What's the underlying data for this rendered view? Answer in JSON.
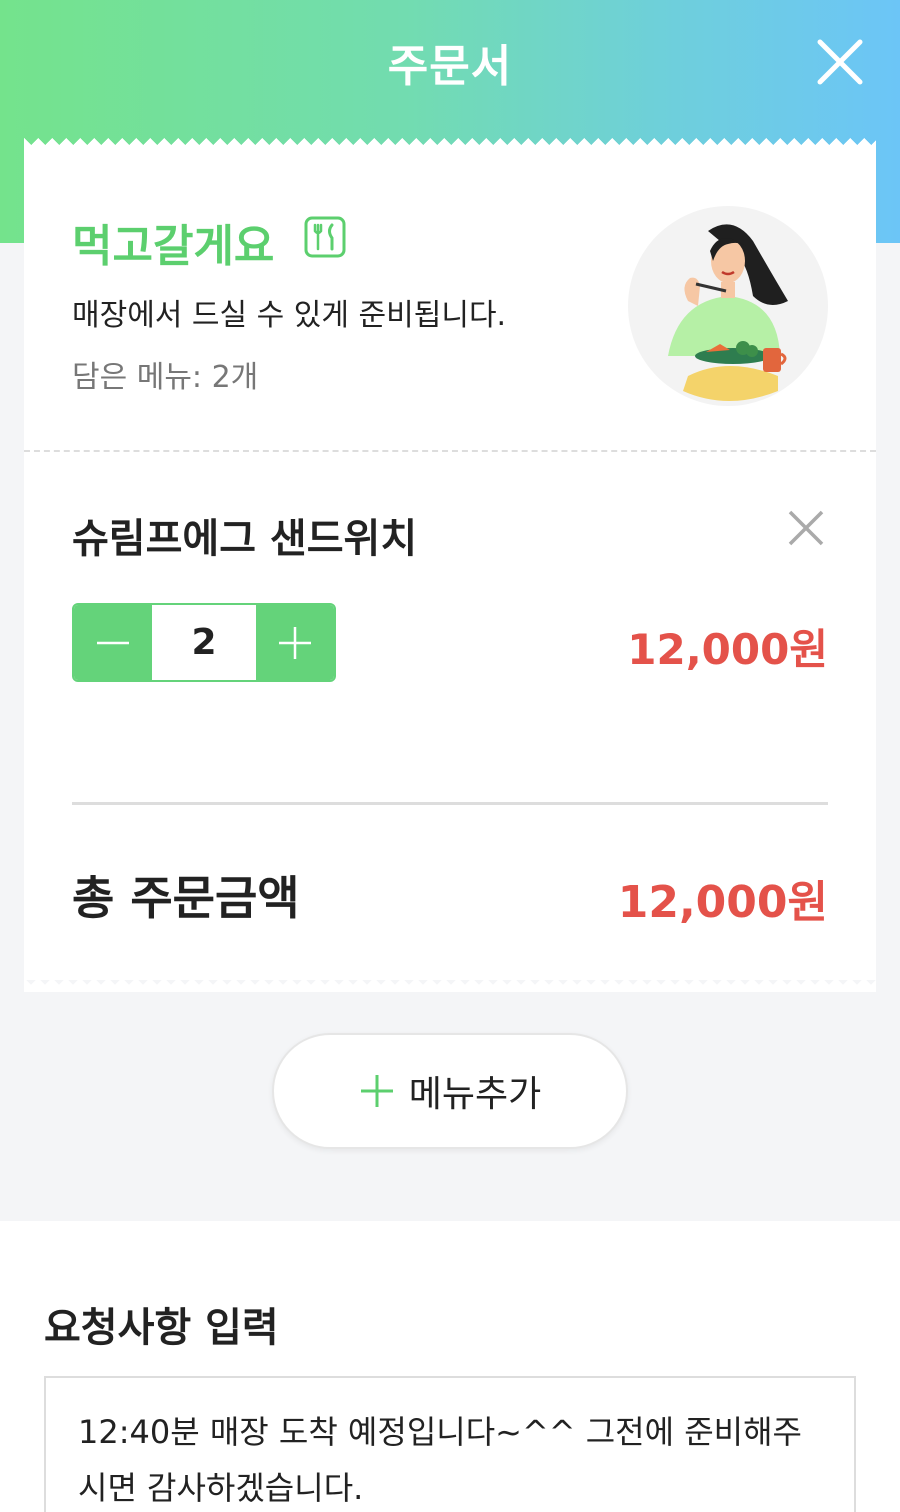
{
  "header": {
    "title": "주문서"
  },
  "dine_option": {
    "title": "먹고갈게요",
    "description": "매장에서 드실 수 있게 준비됩니다.",
    "menu_count": "담은 메뉴: 2개"
  },
  "cart": {
    "items": [
      {
        "name": "슈림프에그 샌드위치",
        "quantity": "2",
        "price": "12,000원"
      }
    ],
    "total_label": "총 주문금액",
    "total_price": "12,000원"
  },
  "add_menu": {
    "label": "메뉴추가"
  },
  "request": {
    "title": "요청사항 입력",
    "text": "12:40분 매장 도착 예정입니다~^^ 그전에 준비해주시면 감사하겠습니다."
  },
  "colors": {
    "brand_green": "#64d37a",
    "price_red": "#e4524a",
    "header_gradient_start": "#74e38c",
    "header_gradient_end": "#6cc5f7"
  },
  "icons": [
    "close-icon",
    "fork-knife-icon",
    "remove-icon",
    "minus-icon",
    "plus-icon"
  ]
}
